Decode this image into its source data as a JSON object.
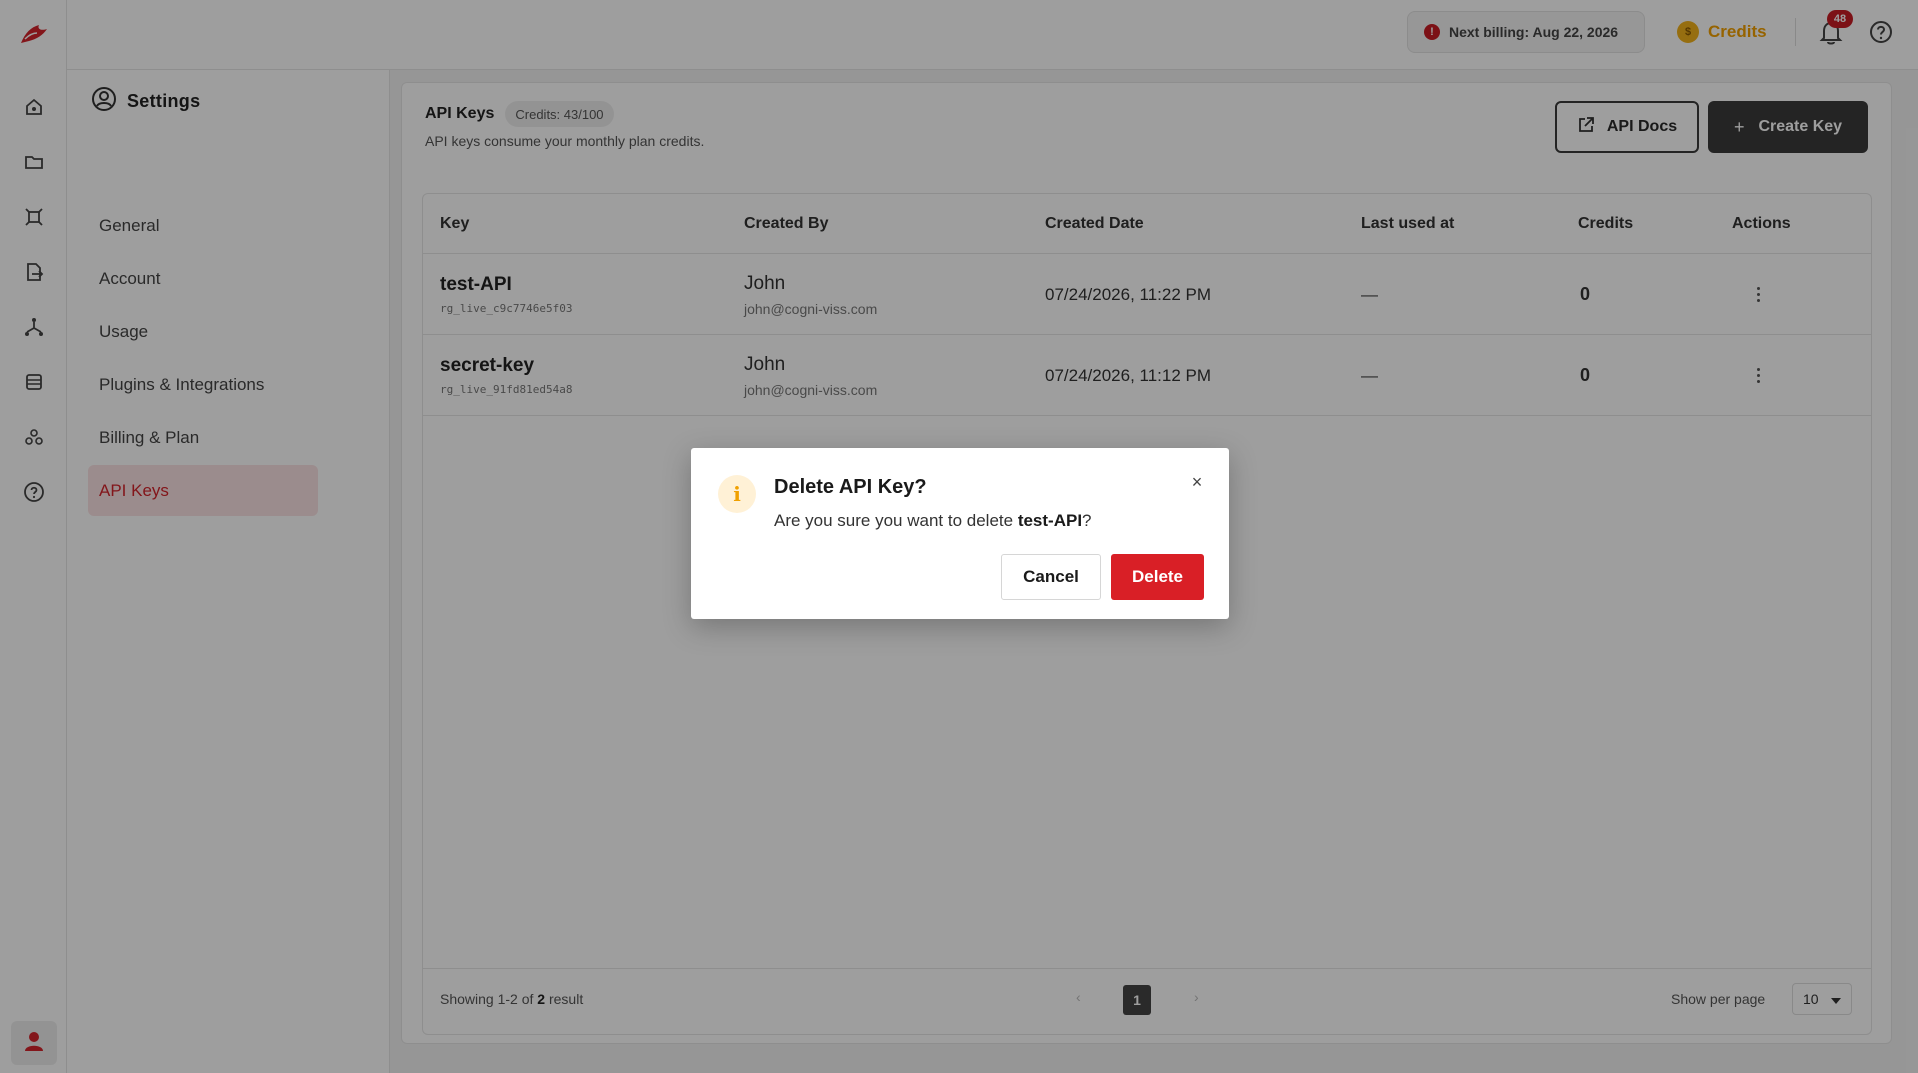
{
  "rail": {
    "icons": [
      "logo-icon",
      "home-icon",
      "folder-icon",
      "frame-icon",
      "document-export-icon",
      "workflow-icon",
      "table-icon",
      "integrations-icon",
      "help-icon",
      "user-icon"
    ]
  },
  "topbar": {
    "billing_text": "Next billing: Aug 22, 2026",
    "billing_icon": "!",
    "credits_label": "Credits",
    "credits_coin": "$",
    "notifications_count": "48"
  },
  "settings": {
    "title": "Settings",
    "items": [
      {
        "label": "General"
      },
      {
        "label": "Account"
      },
      {
        "label": "Usage"
      },
      {
        "label": "Plugins & Integrations"
      },
      {
        "label": "Billing & Plan"
      },
      {
        "label": "API Keys",
        "active": true
      }
    ]
  },
  "main": {
    "title": "API Keys",
    "credits_pill": "Credits: 43/100",
    "subtitle": "API keys consume your monthly plan credits.",
    "docs_button": "API Docs",
    "create_button": "Create Key",
    "create_plus": "+",
    "columns": [
      "Key",
      "Created By",
      "Created Date",
      "Last used at",
      "Credits",
      "Actions"
    ],
    "rows": [
      {
        "name": "test-API",
        "key": "rg_live_c9c7746e5f03",
        "creator": "John",
        "email": "john@cogni-viss.com",
        "created": "07/24/2026, 11:22 PM",
        "last_used": "—",
        "credits": "0"
      },
      {
        "name": "secret-key",
        "key": "rg_live_91fd81ed54a8",
        "creator": "John",
        "email": "john@cogni-viss.com",
        "created": "07/24/2026, 11:12 PM",
        "last_used": "—",
        "credits": "0"
      }
    ],
    "footer": {
      "showing_prefix": "Showing 1-2 of ",
      "showing_total": "2",
      "showing_suffix": " result",
      "prev": "‹",
      "page": "1",
      "next": "›",
      "per_page_label": "Show per page",
      "per_page_value": "10"
    }
  },
  "modal": {
    "title": "Delete API Key?",
    "body_prefix": "Are you sure you want to delete ",
    "body_key": "test-API",
    "body_suffix": "?",
    "info_glyph": "i",
    "close_glyph": "×",
    "cancel": "Cancel",
    "delete": "Delete"
  },
  "colors": {
    "accent": "#d91f26",
    "credits": "#f2a100",
    "dark_button": "#3a3a3a"
  }
}
